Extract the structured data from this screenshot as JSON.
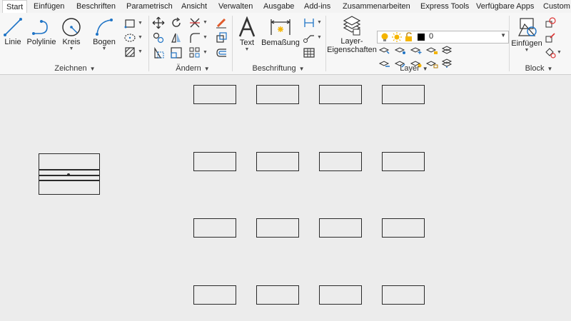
{
  "tabs": [
    "Start",
    "Einfügen",
    "Beschriften",
    "Parametrisch",
    "Ansicht",
    "Verwalten",
    "Ausgabe",
    "Add-ins",
    "Zusammenarbeiten",
    "Express Tools",
    "Verfügbare Apps",
    "Custom"
  ],
  "active_tab": "Start",
  "panels": {
    "zeichnen": {
      "title": "Zeichnen",
      "tools": [
        "Linie",
        "Polylinie",
        "Kreis",
        "Bogen"
      ]
    },
    "aendern": {
      "title": "Ändern"
    },
    "beschriftung": {
      "title": "Beschriftung",
      "tools": [
        "Text",
        "Bemaßung"
      ]
    },
    "layer": {
      "title": "Layer",
      "tool": "Layer-Eigenschaften",
      "tool_line1": "Layer-",
      "tool_line2": "Eigenschaften",
      "current_layer": "0"
    },
    "block": {
      "title": "Block",
      "tool": "Einfügen"
    }
  },
  "colors": {
    "accent": "#1f74c6",
    "bulb": "#f4b400",
    "canvas": "#ececec"
  }
}
